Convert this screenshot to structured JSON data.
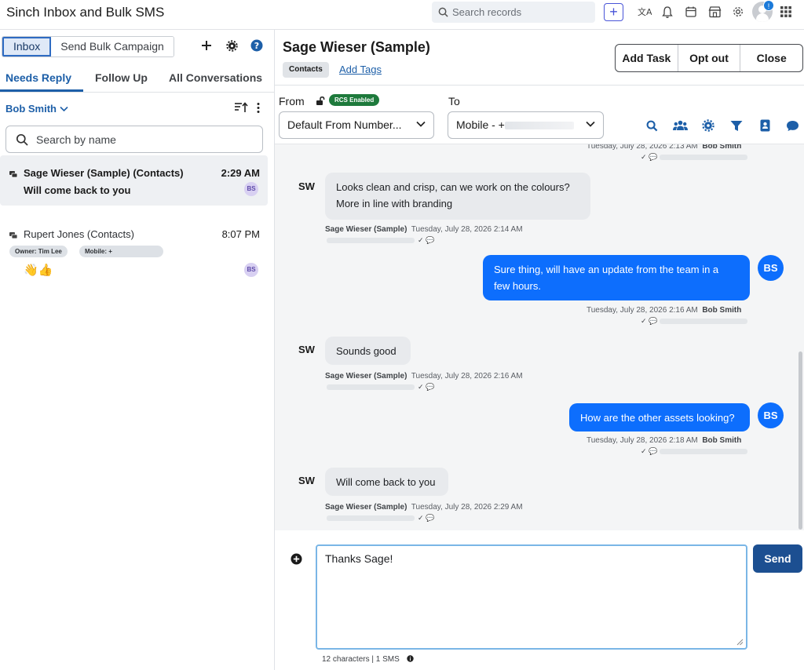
{
  "app": {
    "title": "Sinch Inbox and Bulk SMS"
  },
  "topbar": {
    "search_placeholder": "Search records",
    "icons": [
      "search-icon",
      "add-icon",
      "translate-icon",
      "bell-icon",
      "calendar-icon",
      "store-icon",
      "gear-icon",
      "avatar",
      "apps-grid-icon"
    ],
    "notification_count": "!"
  },
  "left": {
    "segments": [
      "Inbox",
      "Send Bulk Campaign"
    ],
    "tabs": [
      "Needs Reply",
      "Follow Up",
      "All Conversations"
    ],
    "owner": "Bob Smith",
    "search_placeholder": "Search by name",
    "conversations": [
      {
        "name": "Sage Wieser (Sample) (Contacts)",
        "time": "2:29 AM",
        "message": "Will come back to you",
        "initials": "BS"
      },
      {
        "name": "Rupert Jones (Contacts)",
        "time": "8:07 PM",
        "owner_tag": "Owner: Tim Lee",
        "mobile_tag": "Mobile: +",
        "message": "👋👍",
        "initials": "BS"
      }
    ]
  },
  "header": {
    "contact_name": "Sage Wieser (Sample)",
    "chip": "Contacts",
    "add_tags": "Add Tags",
    "actions": [
      "Add Task",
      "Opt out",
      "Close"
    ]
  },
  "routing": {
    "from_label": "From",
    "rcs_badge": "RCS Enabled",
    "from_value": "Default From Number...",
    "to_label": "To",
    "to_value": "Mobile - +"
  },
  "thread": [
    {
      "dir": "out",
      "meta_time": "Tuesday, July 28, 2026 2:13 AM",
      "sender": "Bob Smith"
    },
    {
      "dir": "in",
      "initials": "SW",
      "lines": [
        "Looks clean and crisp, can we work on the colours?",
        "More in line with branding"
      ],
      "sender": "Sage Wieser (Sample)",
      "meta_time": "Tuesday, July 28, 2026 2:14 AM"
    },
    {
      "dir": "out",
      "initials": "BS",
      "lines": [
        "Sure thing, will have an update from the team in a",
        "few hours."
      ],
      "sender": "Bob Smith",
      "meta_time": "Tuesday, July 28, 2026 2:16 AM"
    },
    {
      "dir": "in",
      "initials": "SW",
      "lines": [
        "Sounds good"
      ],
      "sender": "Sage Wieser (Sample)",
      "meta_time": "Tuesday, July 28, 2026 2:16 AM"
    },
    {
      "dir": "out",
      "initials": "BS",
      "lines": [
        "How are the other assets looking?"
      ],
      "sender": "Bob Smith",
      "meta_time": "Tuesday, July 28, 2026 2:18 AM"
    },
    {
      "dir": "in",
      "initials": "SW",
      "lines": [
        "Will come back to you"
      ],
      "sender": "Sage Wieser (Sample)",
      "meta_time": "Tuesday, July 28, 2026 2:29 AM"
    }
  ],
  "composer": {
    "value": "Thanks Sage!",
    "send": "Send",
    "counter": "12 characters  |  1 SMS"
  },
  "colors": {
    "accent": "#0d6efd",
    "brand_dark": "#1c4f91",
    "rcs_green": "#1e7a3c"
  }
}
